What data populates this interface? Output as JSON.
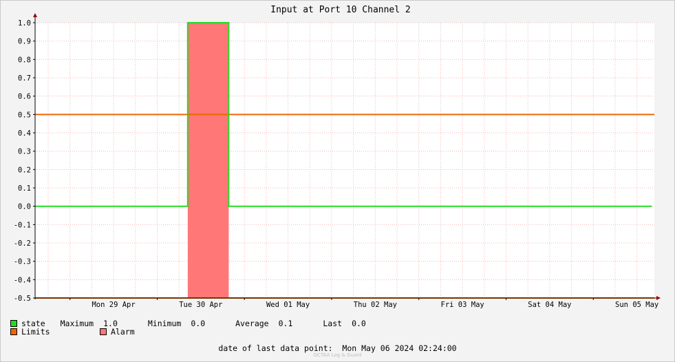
{
  "chart_data": {
    "type": "line",
    "title": "Input at Port 10 Channel 2",
    "ylim": [
      -0.5,
      1.0
    ],
    "yticks": [
      1.0,
      0.9,
      0.8,
      0.7,
      0.6,
      0.5,
      0.4,
      0.3,
      0.2,
      0.1,
      0.0,
      -0.1,
      -0.2,
      -0.3,
      -0.4,
      -0.5
    ],
    "ytick_labels": [
      "1.0",
      "0.9",
      "0.8",
      "0.7",
      "0.6",
      "0.5",
      "0.4",
      "0.3",
      "0.2",
      "0.1",
      "0.0",
      "-0.1",
      "-0.2",
      "-0.3",
      "-0.4",
      "-0.5"
    ],
    "xlim_days": [
      -0.4,
      6.7
    ],
    "x_tick_labels": [
      "Mon 29 Apr",
      "Tue 30 Apr",
      "Wed 01 May",
      "Thu 02 May",
      "Fri 03 May",
      "Sat 04 May",
      "Sun 05 May"
    ],
    "series": [
      {
        "name": "state",
        "color": "#22dd22",
        "points": [
          [
            -0.4,
            0.0
          ],
          [
            1.35,
            0.0
          ],
          [
            1.35,
            1.0
          ],
          [
            1.82,
            1.0
          ],
          [
            1.82,
            0.0
          ],
          [
            6.67,
            0.0
          ]
        ]
      },
      {
        "name": "Limits",
        "color": "#ee6600",
        "lines": [
          0.5,
          -0.5
        ]
      },
      {
        "name": "Alarm",
        "color": "#ff7777",
        "spans": [
          [
            1.35,
            1.82
          ]
        ]
      }
    ],
    "grid": true
  },
  "legend": {
    "state_label": "state",
    "max_label": "Maximum",
    "max_value": "1.0",
    "min_label": "Minimum",
    "min_value": "0.0",
    "avg_label": "Average",
    "avg_value": "0.1",
    "last_label": "Last",
    "last_value": "0.0",
    "limits_label": "Limits",
    "alarm_label": "Alarm",
    "state_color": "#22dd22",
    "limits_color": "#ee6600",
    "alarm_color": "#ff7777"
  },
  "footer": {
    "last_point_text": "date of last data point:  Mon May 06 2024 02:24:00",
    "watermark": "OCTAA Log & Guard"
  }
}
